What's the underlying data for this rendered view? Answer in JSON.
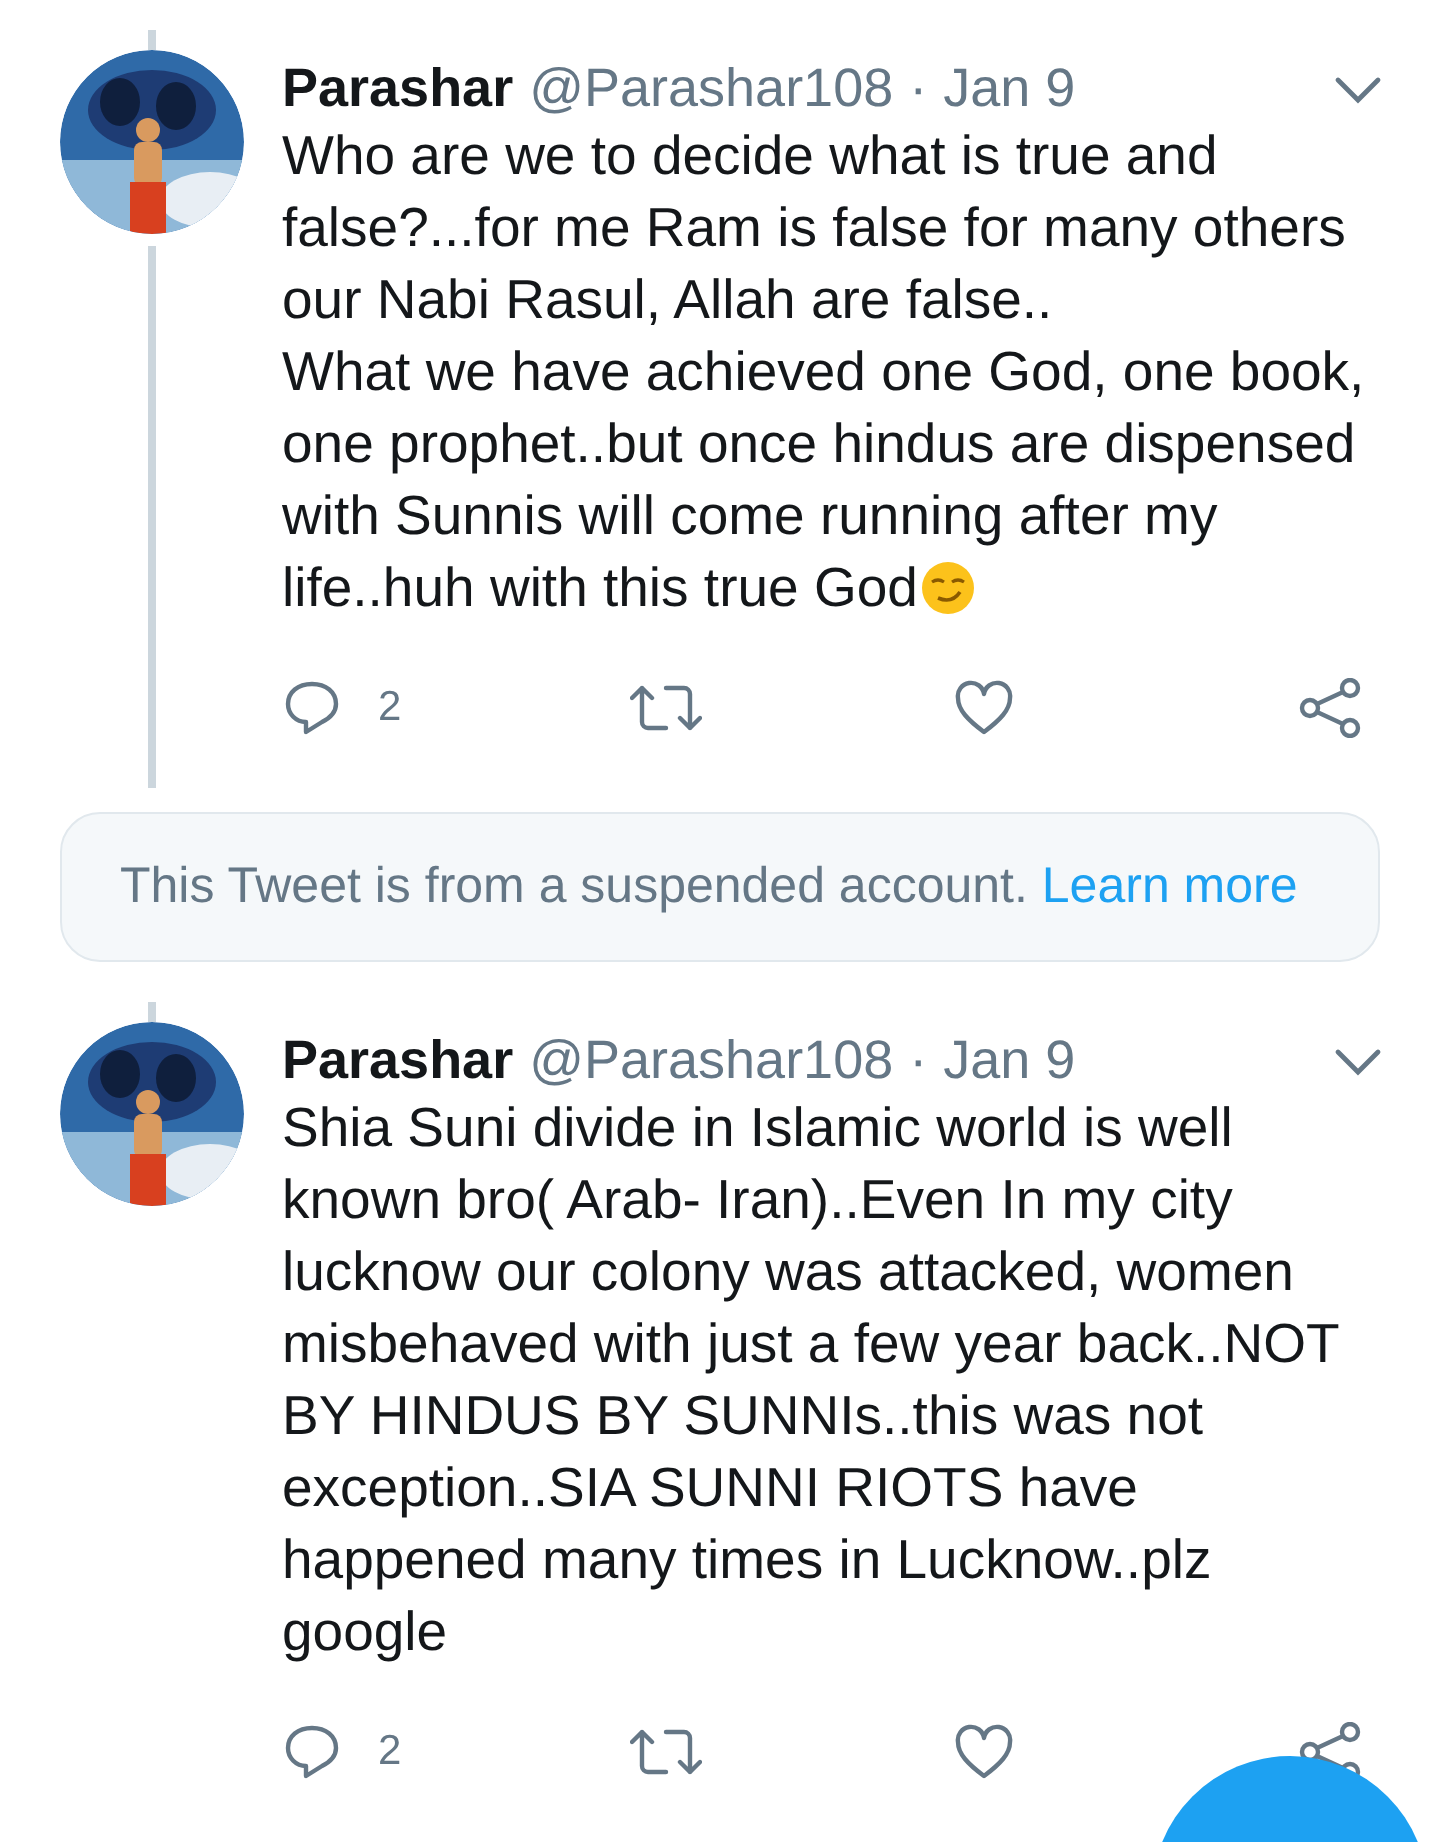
{
  "items": [
    {
      "kind": "tweet",
      "name": "Parashar",
      "handle": "@Parashar108",
      "separator": "·",
      "date": "Jan 9",
      "thread_above": true,
      "thread_below": true,
      "text": "Who are we to decide what is true and false?...for me Ram is false for many others our Nabi Rasul, Allah are false..\nWhat we have achieved one God, one book, one prophet..but once hindus are dispensed with Sunnis will come running after my life..huh with this true God",
      "emoji": true,
      "replies": "2"
    },
    {
      "kind": "notice",
      "text": "This Tweet is from a suspended account.",
      "link": "Learn more"
    },
    {
      "kind": "tweet",
      "name": "Parashar",
      "handle": "@Parashar108",
      "separator": "·",
      "date": "Jan 9",
      "thread_above": true,
      "thread_below": false,
      "text": "Shia Suni divide in Islamic world is well known bro( Arab- Iran)..Even In my city lucknow our colony was attacked, women misbehaved with just a few year back..NOT BY HINDUS BY SUNNIs..this was not exception..SIA SUNNI RIOTS have happened many times in Lucknow..plz google",
      "emoji": false,
      "replies": "2"
    }
  ],
  "compose_button": true
}
